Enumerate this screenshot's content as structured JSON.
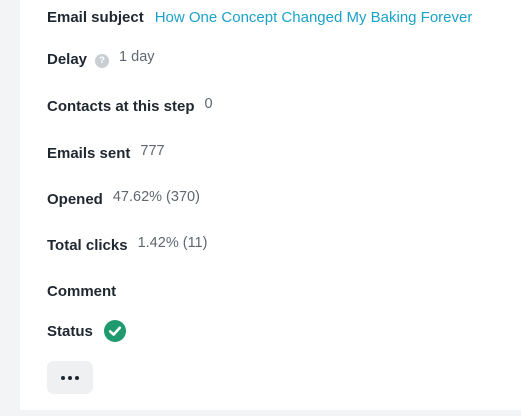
{
  "details": {
    "email_subject": {
      "label": "Email subject",
      "value": "How One Concept Changed My Baking Forever"
    },
    "delay": {
      "label": "Delay",
      "help_icon": "question-mark-circle",
      "help_glyph": "?",
      "value": "1 day"
    },
    "contacts_at_step": {
      "label": "Contacts at this step",
      "value": "0"
    },
    "emails_sent": {
      "label": "Emails sent",
      "value": "777"
    },
    "opened": {
      "label": "Opened",
      "value": "47.62% (370)"
    },
    "total_clicks": {
      "label": "Total clicks",
      "value": "1.42% (11)"
    },
    "comment": {
      "label": "Comment"
    },
    "status": {
      "label": "Status",
      "icon": "check-circle",
      "color": "#1f9a6e"
    }
  },
  "actions": {
    "more_icon": "ellipsis-horizontal"
  },
  "colors": {
    "link": "#1aa2c9",
    "label": "#1f2730",
    "value": "#5f6770",
    "background": "#f3f4f6"
  }
}
